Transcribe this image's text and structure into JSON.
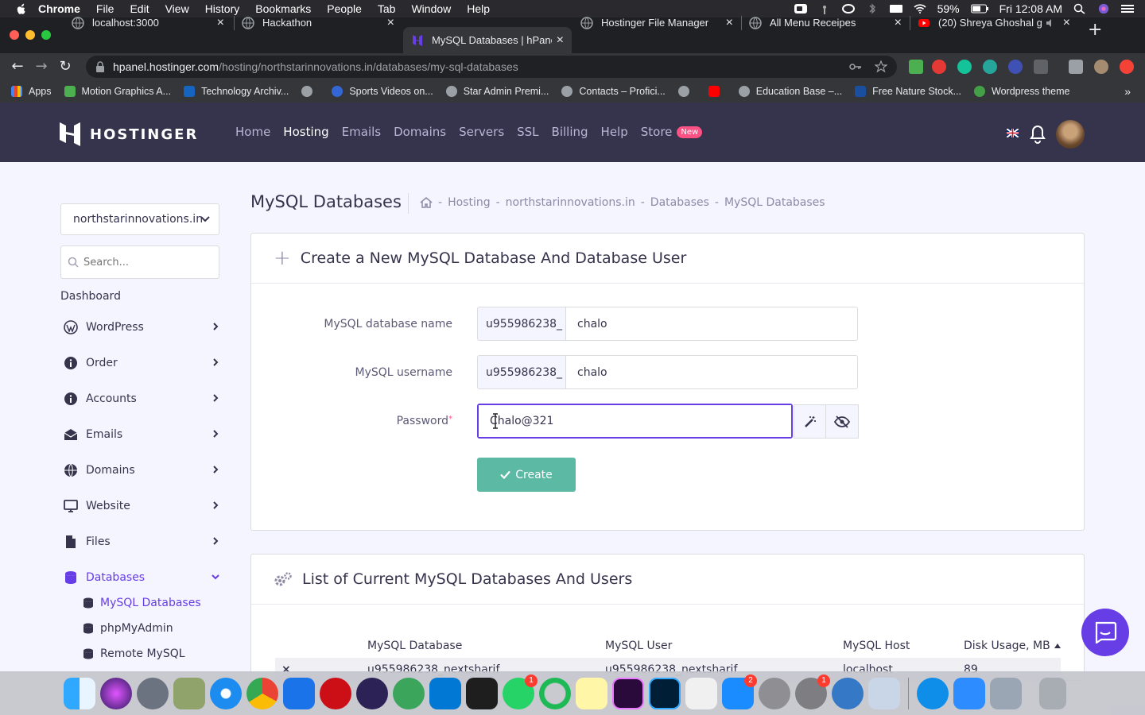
{
  "menubar": {
    "app": "Chrome",
    "items": [
      "File",
      "Edit",
      "View",
      "History",
      "Bookmarks",
      "People",
      "Tab",
      "Window",
      "Help"
    ],
    "battery": "59%",
    "clock": "Fri 12:08 AM"
  },
  "tabs": [
    {
      "title": "localhost:3000",
      "close": "×"
    },
    {
      "title": "Hackathon",
      "close": "×"
    },
    {
      "title": "MySQL Databases | hPanel",
      "close": "×"
    },
    {
      "title": "Hostinger File Manager",
      "close": "×"
    },
    {
      "title": "All Menu Receipes",
      "close": "×"
    },
    {
      "title": "(20) Shreya Ghoshal g",
      "close": "×"
    }
  ],
  "url": {
    "host": "hpanel.hostinger.com",
    "path": "/hosting/northstarinnovations.in/databases/my-sql-databases"
  },
  "bookmarks": [
    "Apps",
    "Motion Graphics A...",
    "Technology Archiv...",
    "Sports Videos on...",
    "Star Admin Premi...",
    "Contacts – Profici...",
    "Education Base –...",
    "Free Nature Stock...",
    "Wordpress theme"
  ],
  "header": {
    "brand": "HOSTINGER",
    "nav": [
      "Home",
      "Hosting",
      "Emails",
      "Domains",
      "Servers",
      "SSL",
      "Billing",
      "Help",
      "Store"
    ],
    "store_badge": "New"
  },
  "sidebar": {
    "domain": "northstarinnovations.in",
    "search_placeholder": "Search...",
    "dashboard": "Dashboard",
    "items": [
      "WordPress",
      "Order",
      "Accounts",
      "Emails",
      "Domains",
      "Website",
      "Files",
      "Databases"
    ],
    "subitems": [
      "MySQL Databases",
      "phpMyAdmin",
      "Remote MySQL"
    ]
  },
  "page": {
    "title": "MySQL Databases",
    "breadcrumb": [
      "Hosting",
      "northstarinnovations.in",
      "Databases",
      "MySQL Databases"
    ],
    "breadcrumb_sep": "-"
  },
  "create_form": {
    "heading": "Create a New MySQL Database And Database User",
    "db_label": "MySQL database name",
    "db_prefix": "u955986238_",
    "db_value": "chalo",
    "user_label": "MySQL username",
    "user_prefix": "u955986238_",
    "user_value": "chalo",
    "password_label": "Password",
    "password_required": "*",
    "password_value": "Chalo@321",
    "create_label": "Create"
  },
  "db_list": {
    "heading": "List of Current MySQL Databases And Users",
    "columns": [
      "MySQL Database",
      "MySQL User",
      "MySQL Host",
      "Disk Usage, MB"
    ],
    "rows": [
      {
        "database": "u955986238_nextsharif",
        "user": "u955986238_nextsharif",
        "host": "localhost",
        "usage": "89"
      }
    ]
  },
  "dock": {
    "badges": {
      "whatsapp": "1",
      "appstore": "2",
      "prefs": "1"
    }
  }
}
